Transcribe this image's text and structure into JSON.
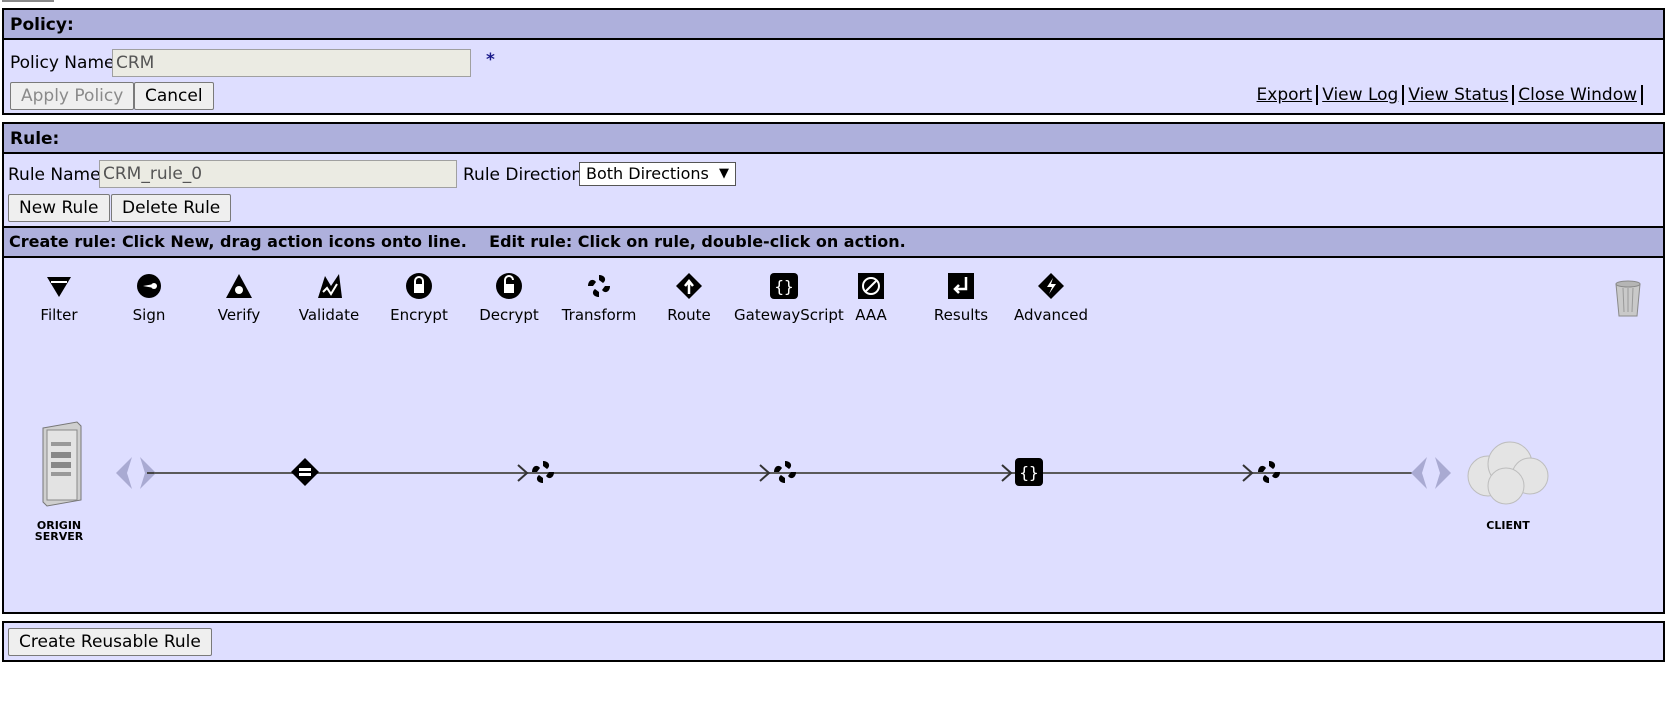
{
  "policy": {
    "header": "Policy:",
    "name_label": "Policy Name:",
    "name_value": "CRM",
    "required_marker": "*",
    "apply_label": "Apply Policy",
    "cancel_label": "Cancel",
    "links": [
      "Export",
      "View Log",
      "View Status",
      "Close Window"
    ]
  },
  "rule": {
    "header": "Rule:",
    "name_label": "Rule Name:",
    "name_value": "CRM_rule_0",
    "direction_label": "Rule Direction:",
    "direction_value": "Both Directions",
    "new_label": "New Rule",
    "delete_label": "Delete Rule"
  },
  "editor": {
    "instructions": "Create rule: Click New, drag action icons onto line.    Edit rule: Click on rule, double-click on action.",
    "palette": [
      {
        "label": "Filter",
        "icon": "filter-icon"
      },
      {
        "label": "Sign",
        "icon": "sign-icon"
      },
      {
        "label": "Verify",
        "icon": "verify-icon"
      },
      {
        "label": "Validate",
        "icon": "validate-icon"
      },
      {
        "label": "Encrypt",
        "icon": "encrypt-icon"
      },
      {
        "label": "Decrypt",
        "icon": "decrypt-icon"
      },
      {
        "label": "Transform",
        "icon": "transform-icon"
      },
      {
        "label": "Route",
        "icon": "route-icon"
      },
      {
        "label": "GatewayScript",
        "icon": "gatewayscript-icon"
      },
      {
        "label": "AAA",
        "icon": "aaa-icon"
      },
      {
        "label": "Results",
        "icon": "results-icon"
      },
      {
        "label": "Advanced",
        "icon": "advanced-icon"
      }
    ],
    "origin_label": "ORIGIN SERVER",
    "client_label": "CLIENT"
  },
  "footer": {
    "reusable_label": "Create Reusable Rule"
  }
}
